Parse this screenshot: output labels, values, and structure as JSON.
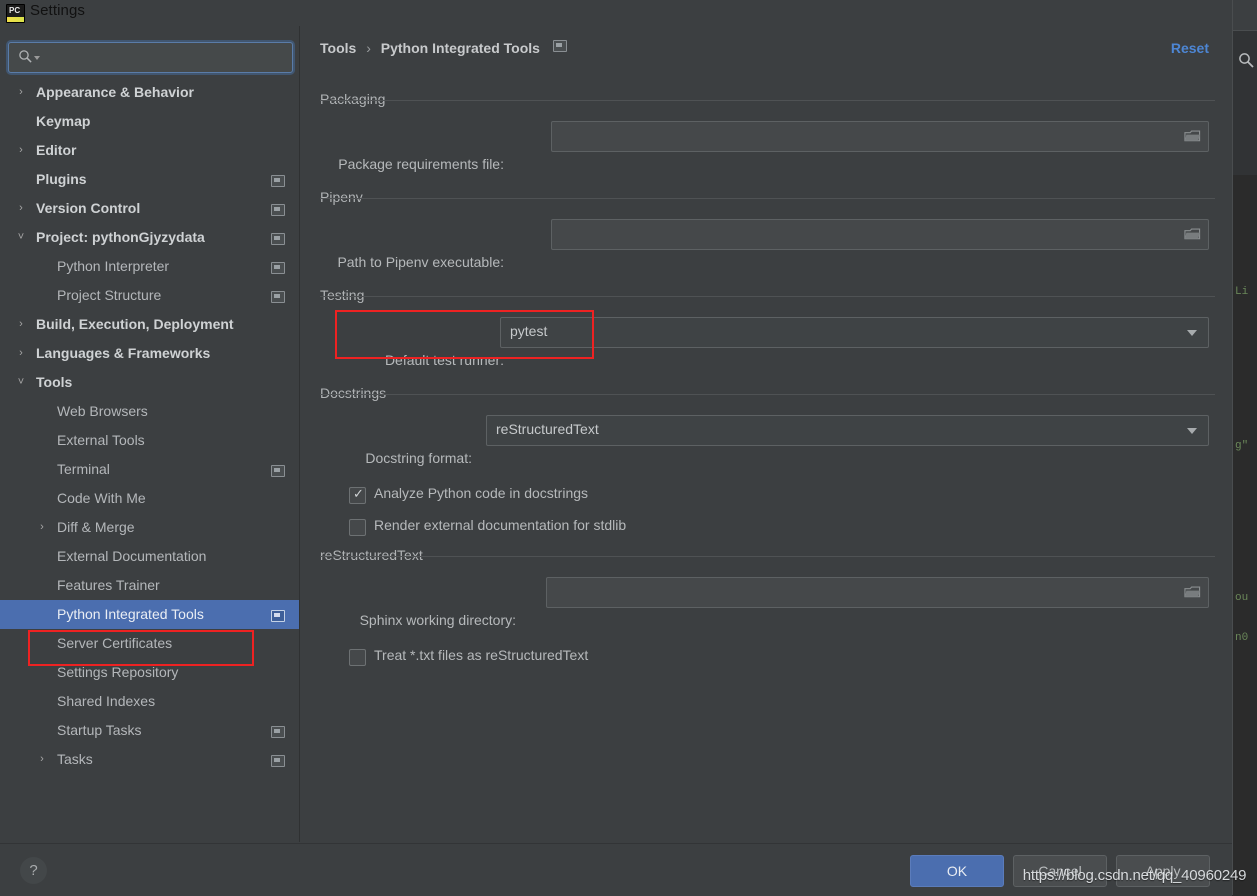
{
  "window": {
    "title": "Settings",
    "app_icon": "pycharm-icon",
    "close_label": "✕"
  },
  "sidebar": {
    "search": {
      "value": "",
      "placeholder": "",
      "icon": "search-icon"
    },
    "items": [
      {
        "label": "Appearance & Behavior",
        "arrow": "›",
        "indent": 36,
        "bold": true,
        "module": false,
        "selected": false
      },
      {
        "label": "Keymap",
        "arrow": "",
        "indent": 36,
        "bold": true,
        "module": false,
        "selected": false
      },
      {
        "label": "Editor",
        "arrow": "›",
        "indent": 36,
        "bold": true,
        "module": false,
        "selected": false
      },
      {
        "label": "Plugins",
        "arrow": "",
        "indent": 36,
        "bold": true,
        "module": true,
        "selected": false
      },
      {
        "label": "Version Control",
        "arrow": "›",
        "indent": 36,
        "bold": true,
        "module": true,
        "selected": false
      },
      {
        "label": "Project: pythonGjyzydata",
        "arrow": "˅",
        "indent": 36,
        "bold": true,
        "module": true,
        "selected": false
      },
      {
        "label": "Python Interpreter",
        "arrow": "",
        "indent": 57,
        "bold": false,
        "module": true,
        "selected": false
      },
      {
        "label": "Project Structure",
        "arrow": "",
        "indent": 57,
        "bold": false,
        "module": true,
        "selected": false
      },
      {
        "label": "Build, Execution, Deployment",
        "arrow": "›",
        "indent": 36,
        "bold": true,
        "module": false,
        "selected": false
      },
      {
        "label": "Languages & Frameworks",
        "arrow": "›",
        "indent": 36,
        "bold": true,
        "module": false,
        "selected": false
      },
      {
        "label": "Tools",
        "arrow": "˅",
        "indent": 36,
        "bold": true,
        "module": false,
        "selected": false
      },
      {
        "label": "Web Browsers",
        "arrow": "",
        "indent": 57,
        "bold": false,
        "module": false,
        "selected": false
      },
      {
        "label": "External Tools",
        "arrow": "",
        "indent": 57,
        "bold": false,
        "module": false,
        "selected": false
      },
      {
        "label": "Terminal",
        "arrow": "",
        "indent": 57,
        "bold": false,
        "module": true,
        "selected": false
      },
      {
        "label": "Code With Me",
        "arrow": "",
        "indent": 57,
        "bold": false,
        "module": false,
        "selected": false
      },
      {
        "label": "Diff & Merge",
        "arrow": "›",
        "indent": 57,
        "bold": false,
        "module": false,
        "selected": false
      },
      {
        "label": "External Documentation",
        "arrow": "",
        "indent": 57,
        "bold": false,
        "module": false,
        "selected": false
      },
      {
        "label": "Features Trainer",
        "arrow": "",
        "indent": 57,
        "bold": false,
        "module": false,
        "selected": false
      },
      {
        "label": "Python Integrated Tools",
        "arrow": "",
        "indent": 57,
        "bold": false,
        "module": true,
        "selected": true
      },
      {
        "label": "Server Certificates",
        "arrow": "",
        "indent": 57,
        "bold": false,
        "module": false,
        "selected": false
      },
      {
        "label": "Settings Repository",
        "arrow": "",
        "indent": 57,
        "bold": false,
        "module": false,
        "selected": false
      },
      {
        "label": "Shared Indexes",
        "arrow": "",
        "indent": 57,
        "bold": false,
        "module": false,
        "selected": false
      },
      {
        "label": "Startup Tasks",
        "arrow": "",
        "indent": 57,
        "bold": false,
        "module": true,
        "selected": false
      },
      {
        "label": "Tasks",
        "arrow": "›",
        "indent": 57,
        "bold": false,
        "module": true,
        "selected": false
      }
    ]
  },
  "content": {
    "breadcrumb": {
      "root": "Tools",
      "separator": "›",
      "leaf": "Python Integrated Tools"
    },
    "reset_label": "Reset",
    "sections": [
      {
        "title": "Packaging"
      },
      {
        "title": "Pipenv"
      },
      {
        "title": "Testing"
      },
      {
        "title": "Docstrings"
      },
      {
        "title": "reStructuredText"
      }
    ],
    "fields": {
      "package_requirements": {
        "label": "Package requirements file:",
        "value": "",
        "icon": "folder-icon"
      },
      "pipenv_path": {
        "label": "Path to Pipenv executable:",
        "value": "",
        "icon": "folder-icon"
      },
      "default_test_runner": {
        "label": "Default test runner:",
        "value": "pytest",
        "icon": "chevron-down-icon"
      },
      "docstring_format": {
        "label": "Docstring format:",
        "value": "reStructuredText",
        "icon": "chevron-down-icon"
      },
      "sphinx_dir": {
        "label": "Sphinx working directory:",
        "value": "",
        "icon": "folder-icon"
      }
    },
    "checkboxes": [
      {
        "label": "Analyze Python code in docstrings",
        "checked": true,
        "tick": "✓"
      },
      {
        "label": "Render external documentation for stdlib",
        "checked": false,
        "tick": ""
      },
      {
        "label": "Treat *.txt files as reStructuredText",
        "checked": false,
        "tick": ""
      }
    ]
  },
  "footer": {
    "help_label": "?",
    "ok_label": "OK",
    "cancel_label": "Cancel",
    "apply_label": "Apply"
  },
  "watermark": "https://blog.csdn.net/qq_40960249",
  "colors": {
    "accent": "#4b6eaf",
    "link": "#4d86d4",
    "panel": "#3c3f41",
    "annotation": "#ee2222"
  }
}
